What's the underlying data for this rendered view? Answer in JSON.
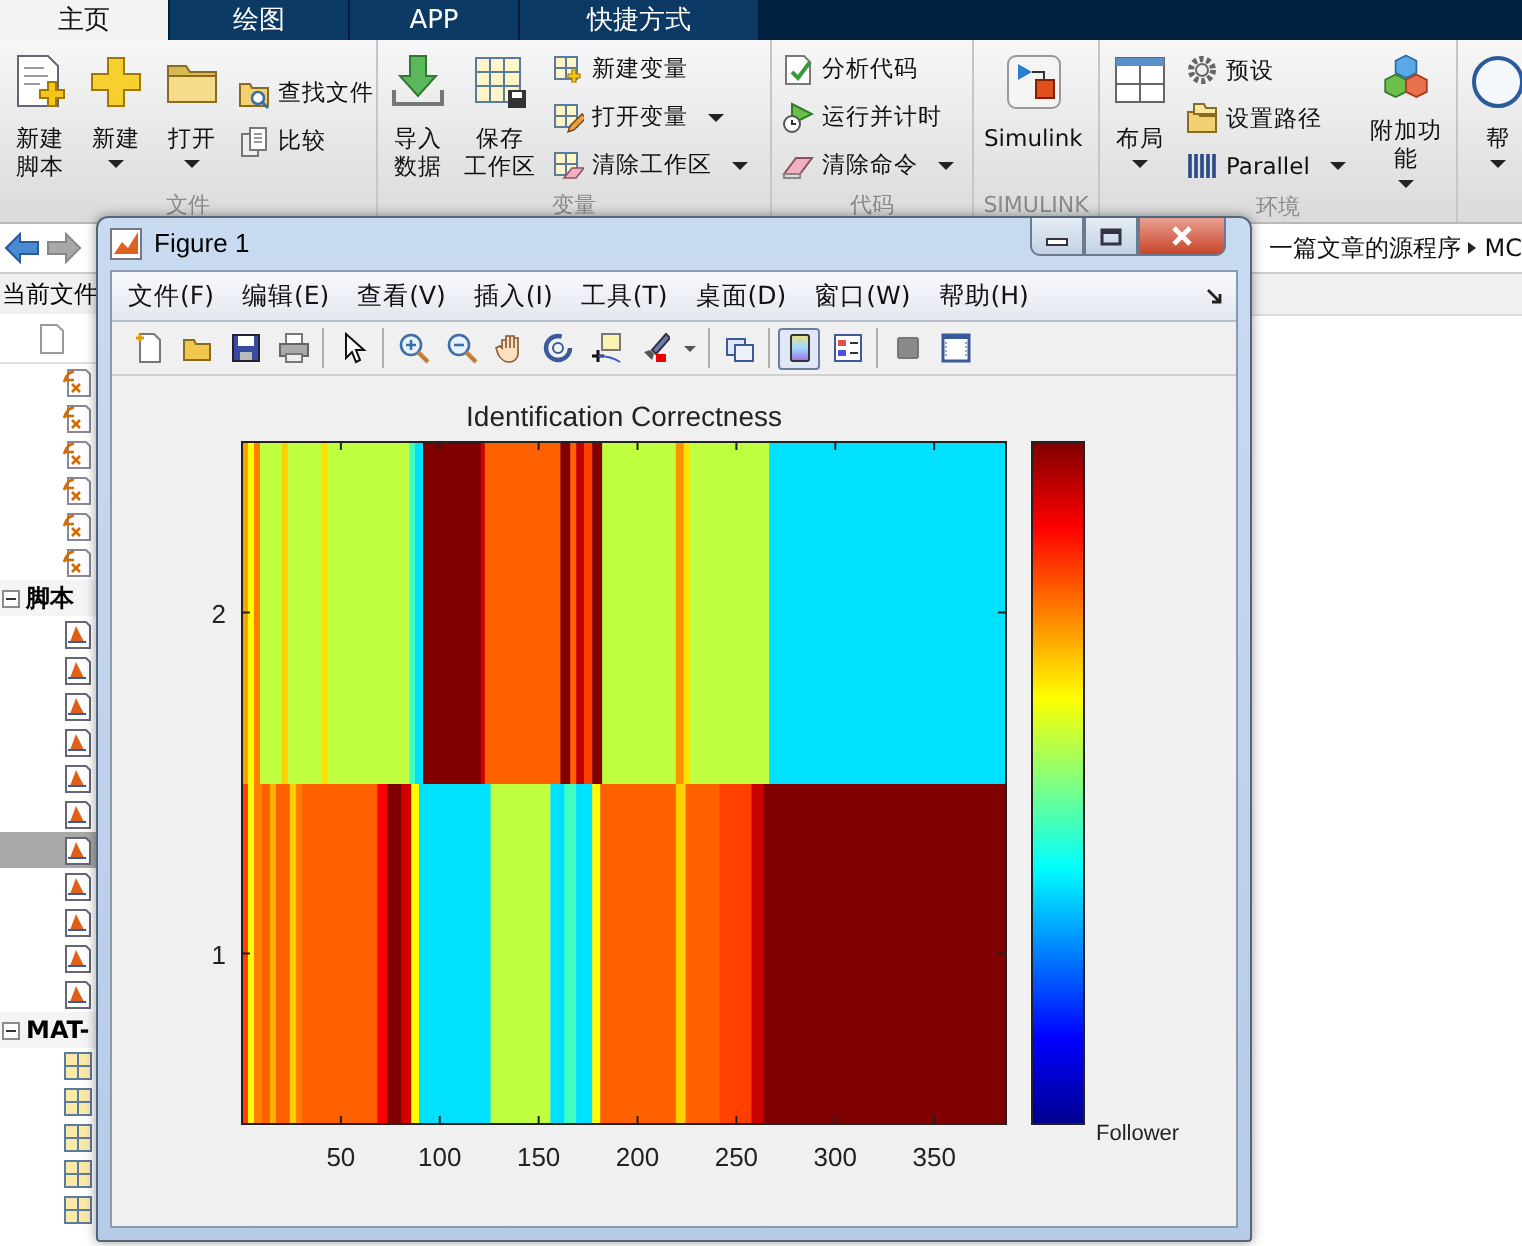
{
  "tabs": [
    {
      "label": "主页",
      "selected": true
    },
    {
      "label": "绘图",
      "selected": false
    },
    {
      "label": "APP",
      "selected": false
    },
    {
      "label": "快捷方式",
      "selected": false
    }
  ],
  "ribbon_groups": [
    {
      "title": "文件",
      "columns": [
        {
          "kind": "large",
          "lines": [
            "新建",
            "脚本"
          ],
          "dropdown": false
        },
        {
          "kind": "large",
          "lines": [
            "新建"
          ],
          "dropdown": true
        },
        {
          "kind": "large",
          "lines": [
            "打开"
          ],
          "dropdown": true
        },
        {
          "kind": "stack",
          "items": [
            {
              "label": "查找文件",
              "dropdown": false
            },
            {
              "label": "比较",
              "dropdown": false
            }
          ]
        }
      ]
    },
    {
      "title": "变量",
      "columns": [
        {
          "kind": "large",
          "lines": [
            "导入",
            "数据"
          ],
          "dropdown": false
        },
        {
          "kind": "large",
          "lines": [
            "保存",
            "工作区"
          ],
          "dropdown": false
        },
        {
          "kind": "stack",
          "items": [
            {
              "label": "新建变量",
              "dropdown": false
            },
            {
              "label": "打开变量",
              "dropdown": true
            },
            {
              "label": "清除工作区",
              "dropdown": true
            }
          ]
        }
      ]
    },
    {
      "title": "代码",
      "columns": [
        {
          "kind": "stack",
          "items": [
            {
              "label": "分析代码",
              "dropdown": false
            },
            {
              "label": "运行并计时",
              "dropdown": false
            },
            {
              "label": "清除命令",
              "dropdown": true
            }
          ]
        }
      ]
    },
    {
      "title": "SIMULINK",
      "columns": [
        {
          "kind": "large",
          "lines": [
            "Simulink"
          ],
          "dropdown": false
        }
      ]
    },
    {
      "title": "环境",
      "columns": [
        {
          "kind": "large",
          "lines": [
            "布局"
          ],
          "dropdown": true
        },
        {
          "kind": "stack",
          "items": [
            {
              "label": "预设",
              "dropdown": false
            },
            {
              "label": "设置路径",
              "dropdown": false
            },
            {
              "label": "Parallel",
              "dropdown": true
            }
          ]
        },
        {
          "kind": "large",
          "lines": [
            "附加功能"
          ],
          "dropdown": true
        }
      ]
    },
    {
      "columns": [
        {
          "kind": "large",
          "lines": [
            "帮"
          ],
          "dropdown": true
        }
      ]
    }
  ],
  "address_bar": {
    "path": [
      "一篇文章的源程序",
      "MC"
    ]
  },
  "file_browser": {
    "title": "当前文件",
    "groups": [
      {
        "kind": "function",
        "items": [
          {
            "selected": false
          },
          {
            "selected": false
          },
          {
            "selected": false
          },
          {
            "selected": false
          },
          {
            "selected": false
          },
          {
            "selected": false
          }
        ]
      },
      {
        "kind": "script",
        "label": "脚本",
        "expanded": true,
        "items": [
          {
            "selected": false
          },
          {
            "selected": false
          },
          {
            "selected": false
          },
          {
            "selected": false
          },
          {
            "selected": false
          },
          {
            "selected": false
          },
          {
            "selected": true
          },
          {
            "selected": false
          },
          {
            "selected": false
          },
          {
            "selected": false
          },
          {
            "selected": false
          }
        ]
      },
      {
        "kind": "mat",
        "label": "MAT-",
        "expanded": true,
        "items": [
          {
            "selected": false
          },
          {
            "selected": false
          },
          {
            "selected": false
          },
          {
            "selected": false
          },
          {
            "selected": false
          }
        ]
      }
    ]
  },
  "figure_window": {
    "title": "Figure 1",
    "menu": [
      "文件(F)",
      "编辑(E)",
      "查看(V)",
      "插入(I)",
      "工具(T)",
      "桌面(D)",
      "窗口(W)",
      "帮助(H)"
    ],
    "toolbar": [
      [
        {
          "selected": false,
          "dropdown": false
        },
        {
          "selected": false,
          "dropdown": false
        },
        {
          "selected": false,
          "dropdown": false
        },
        {
          "selected": false,
          "dropdown": false
        }
      ],
      [
        {
          "selected": false,
          "dropdown": false
        }
      ],
      [
        {
          "selected": false,
          "dropdown": false
        },
        {
          "selected": false,
          "dropdown": false
        },
        {
          "selected": false,
          "dropdown": false
        },
        {
          "selected": false,
          "dropdown": false
        },
        {
          "selected": false,
          "dropdown": false
        },
        {
          "selected": false,
          "dropdown": true
        }
      ],
      [
        {
          "selected": false,
          "dropdown": false
        }
      ],
      [
        {
          "selected": true,
          "dropdown": false
        },
        {
          "selected": false,
          "dropdown": false
        }
      ],
      [
        {
          "selected": false,
          "dropdown": false
        },
        {
          "selected": false,
          "dropdown": false
        }
      ]
    ],
    "plot": {
      "title": "Identification Correctness",
      "xtick_labels": [
        "50",
        "100",
        "150",
        "200",
        "250",
        "300",
        "350"
      ],
      "ytick_labels": [
        "2",
        "1"
      ],
      "colorbar_label": "Follower"
    }
  }
}
